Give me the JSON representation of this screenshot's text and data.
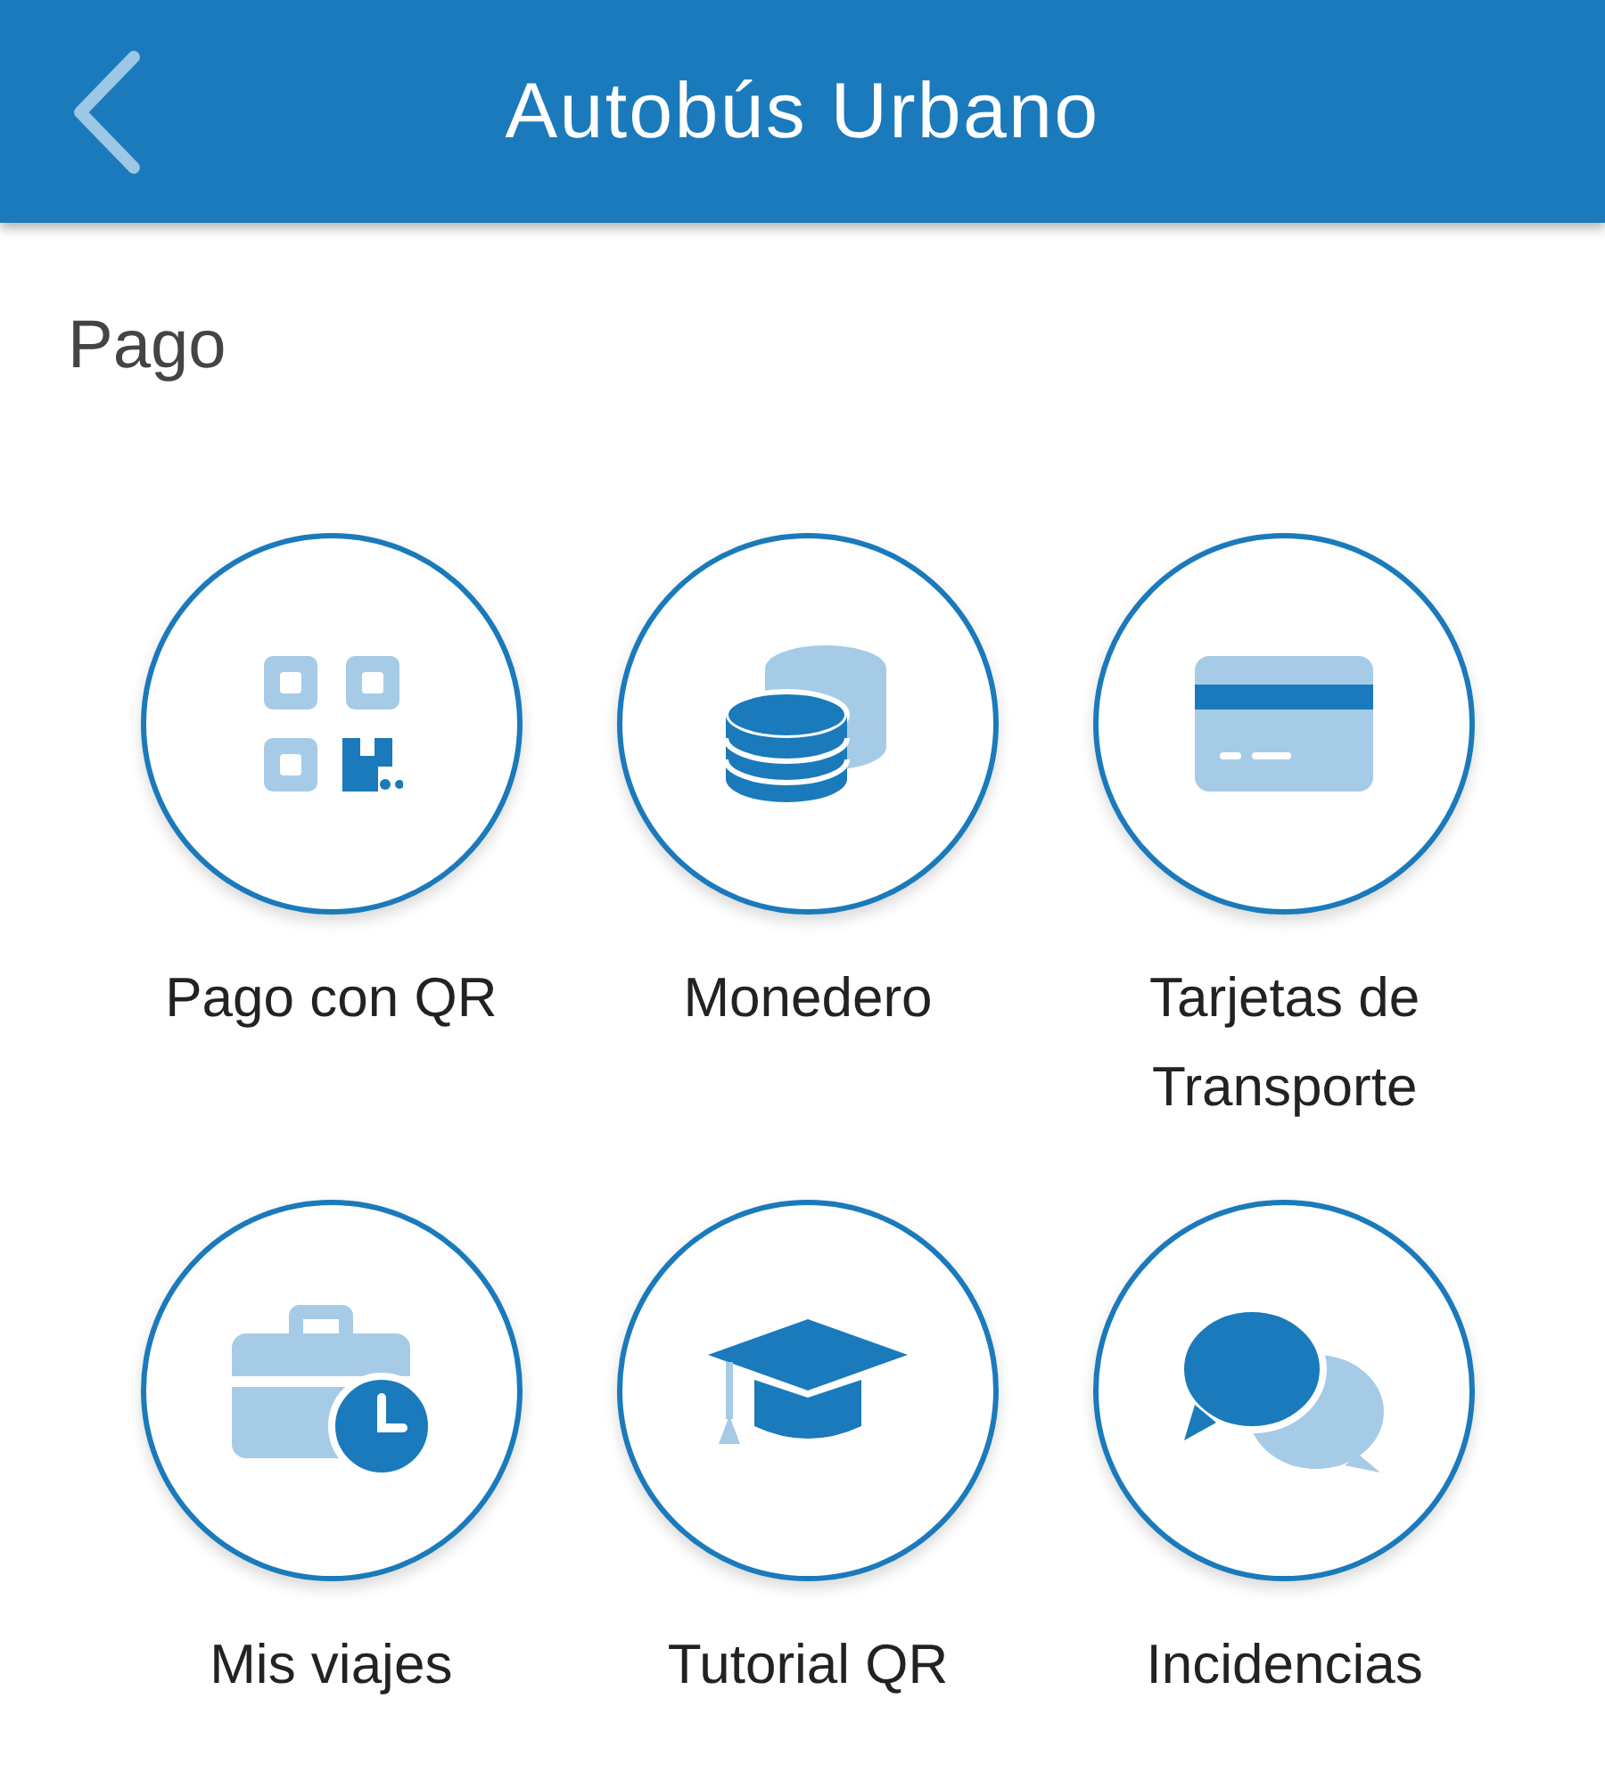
{
  "header": {
    "title": "Autobús Urbano"
  },
  "section": {
    "title": "Pago"
  },
  "items": [
    {
      "kind": "qr",
      "label": "Pago con QR"
    },
    {
      "kind": "coins",
      "label": "Monedero"
    },
    {
      "kind": "card",
      "label": "Tarjetas de Transporte"
    },
    {
      "kind": "trips",
      "label": "Mis viajes"
    },
    {
      "kind": "tutorial",
      "label": "Tutorial QR"
    },
    {
      "kind": "chat",
      "label": "Incidencias"
    }
  ]
}
